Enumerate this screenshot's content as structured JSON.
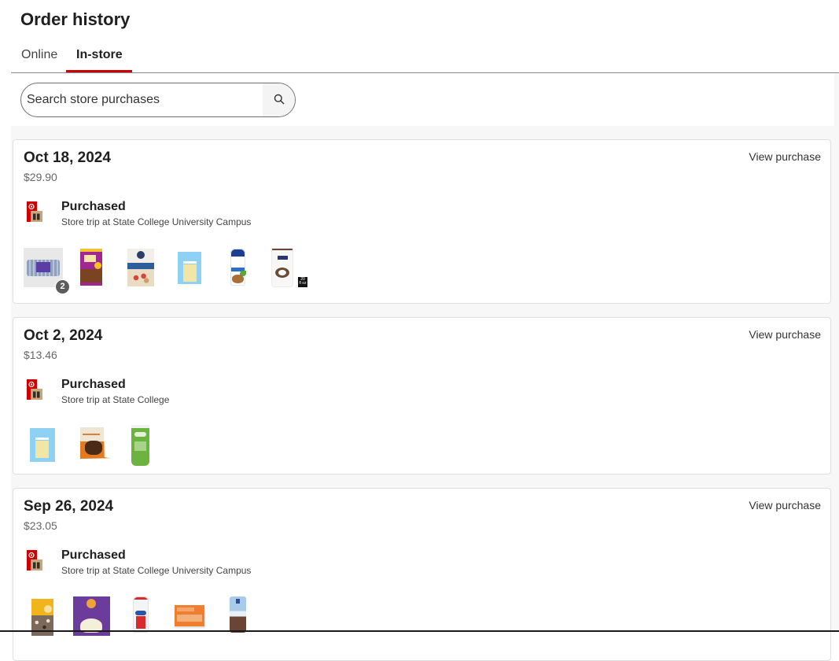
{
  "page": {
    "title": "Order history"
  },
  "tabs": [
    {
      "label": "Online",
      "active": false
    },
    {
      "label": "In-store",
      "active": true
    }
  ],
  "search": {
    "placeholder": "Search store purchases",
    "value": "",
    "button_icon": "search-icon"
  },
  "colors": {
    "accent": "#cc0000",
    "text": "#1f1f1f",
    "muted_text": "#666666",
    "page_background": "#f7f7f7",
    "card_border": "#dfdfdf",
    "quantity_badge": "#5c5c5c"
  },
  "orders": [
    {
      "date": "Oct 18, 2024",
      "total": "$29.90",
      "action_label": "View purchase",
      "status": "Purchased",
      "status_icon": "target-store-icon",
      "location": "Store trip at State College University Campus",
      "items": [
        {
          "kind": "wipes-pack",
          "quantity_badge": "2"
        },
        {
          "kind": "raisin-bran-cereal-box"
        },
        {
          "kind": "quaker-oatmeal-box"
        },
        {
          "kind": "cheese-slices-pack"
        },
        {
          "kind": "shampoo-bottle"
        },
        {
          "kind": "dove-body-wash-bottle",
          "size_badge": {
            "value": "20",
            "unit": "fl oz"
          }
        }
      ]
    },
    {
      "date": "Oct 2, 2024",
      "total": "$13.46",
      "action_label": "View purchase",
      "status": "Purchased",
      "status_icon": "target-store-icon",
      "location": "Store trip at State College",
      "items": [
        {
          "kind": "cheese-slices-pack"
        },
        {
          "kind": "cookie-bag"
        },
        {
          "kind": "face-wash-tube"
        }
      ]
    },
    {
      "date": "Sep 26, 2024",
      "total": "$23.05",
      "action_label": "View purchase",
      "status": "Purchased",
      "status_icon": "target-store-icon",
      "location": "Store trip at State College University Campus",
      "items": [
        {
          "kind": "trail-mix-bag"
        },
        {
          "kind": "mac-cheese-box"
        },
        {
          "kind": "milk-jug"
        },
        {
          "kind": "snack-package"
        },
        {
          "kind": "oats-canister"
        }
      ]
    }
  ]
}
